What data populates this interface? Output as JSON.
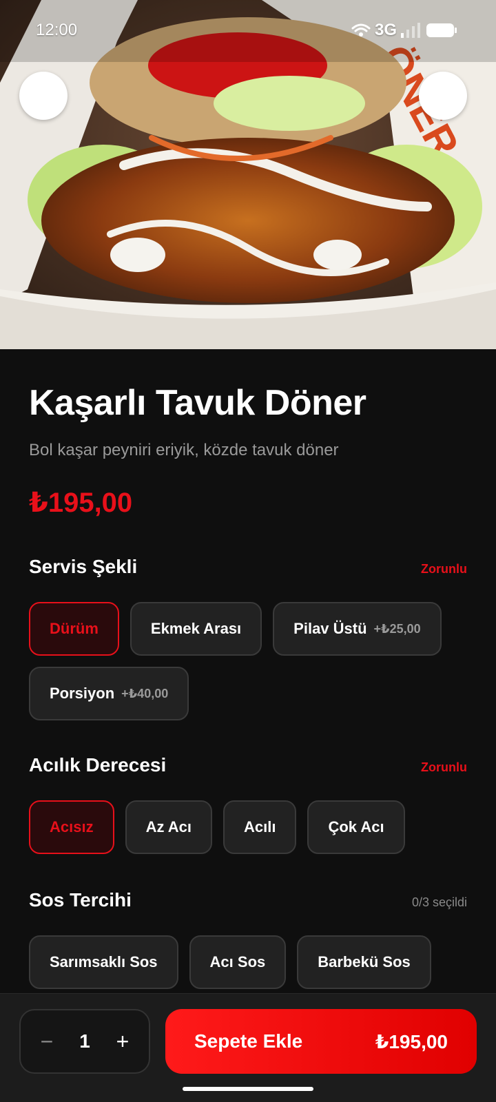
{
  "status": {
    "time": "12:00",
    "network": "3G"
  },
  "hero": {
    "back_icon": "chevron-left-icon",
    "favorite_icon": "heart-icon",
    "image_desc": "doner wrap photo"
  },
  "product": {
    "title": "Kaşarlı Tavuk Döner",
    "description": "Bol kaşar peyniri eriyik, közde tavuk döner",
    "price": "₺195,00"
  },
  "sections": {
    "serving": {
      "title": "Servis Şekli",
      "badge": "Zorunlu",
      "options": [
        {
          "label": "Dürüm",
          "extra": ""
        },
        {
          "label": "Ekmek Arası",
          "extra": ""
        },
        {
          "label": "Pilav Üstü",
          "extra": "+₺25,00"
        },
        {
          "label": "Porsiyon",
          "extra": "+₺40,00"
        }
      ]
    },
    "spice": {
      "title": "Acılık Derecesi",
      "badge": "Zorunlu",
      "options": [
        {
          "label": "Acısız"
        },
        {
          "label": "Az Acı"
        },
        {
          "label": "Acılı"
        },
        {
          "label": "Çok Acı"
        }
      ]
    },
    "sauce": {
      "title": "Sos Tercihi",
      "count": "0/3 seçildi",
      "options": [
        {
          "label": "Sarımsaklı Sos"
        },
        {
          "label": "Acı Sos"
        },
        {
          "label": "Barbekü Sos"
        }
      ]
    }
  },
  "bottom": {
    "quantity": "1",
    "minus": "−",
    "plus": "+",
    "add_label": "Sepete Ekle",
    "add_price": "₺195,00"
  },
  "colors": {
    "accent": "#e8101a",
    "background": "#0f0f0f",
    "chip": "#222222"
  }
}
